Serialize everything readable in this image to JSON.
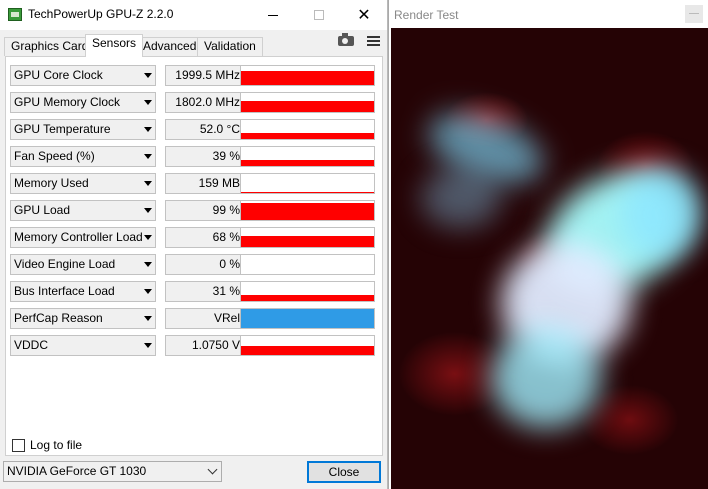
{
  "gpuz": {
    "title": "TechPowerUp GPU-Z 2.2.0",
    "tabs": [
      "Graphics Card",
      "Sensors",
      "Advanced",
      "Validation"
    ],
    "active_tab": "Sensors",
    "sensors": [
      {
        "label": "GPU Core Clock",
        "value": "1999.5 MHz",
        "level": 0.75,
        "color": "#ff0000"
      },
      {
        "label": "GPU Memory Clock",
        "value": "1802.0 MHz",
        "level": 0.6,
        "color": "#ff0000"
      },
      {
        "label": "GPU Temperature",
        "value": "52.0 °C",
        "level": 0.3,
        "color": "#ff0000"
      },
      {
        "label": "Fan Speed (%)",
        "value": "39 %",
        "level": 0.3,
        "color": "#ff0000"
      },
      {
        "label": "Memory Used",
        "value": "159 MB",
        "level": 0.05,
        "color": "#ff0000"
      },
      {
        "label": "GPU Load",
        "value": "99 %",
        "level": 0.9,
        "color": "#ff0000"
      },
      {
        "label": "Memory Controller Load",
        "value": "68 %",
        "level": 0.6,
        "color": "#ff0000"
      },
      {
        "label": "Video Engine Load",
        "value": "0 %",
        "level": 0.0,
        "color": "#ff0000"
      },
      {
        "label": "Bus Interface Load",
        "value": "31 %",
        "level": 0.3,
        "color": "#ff0000"
      },
      {
        "label": "PerfCap Reason",
        "value": "VRel",
        "level": 1.0,
        "color": "#2f9be6"
      },
      {
        "label": "VDDC",
        "value": "1.0750 V",
        "level": 0.45,
        "color": "#ff0000"
      }
    ],
    "log_to_file": "Log to file",
    "gpu_select": "NVIDIA GeForce GT 1030",
    "close_label": "Close"
  },
  "render": {
    "title": "Render Test"
  }
}
